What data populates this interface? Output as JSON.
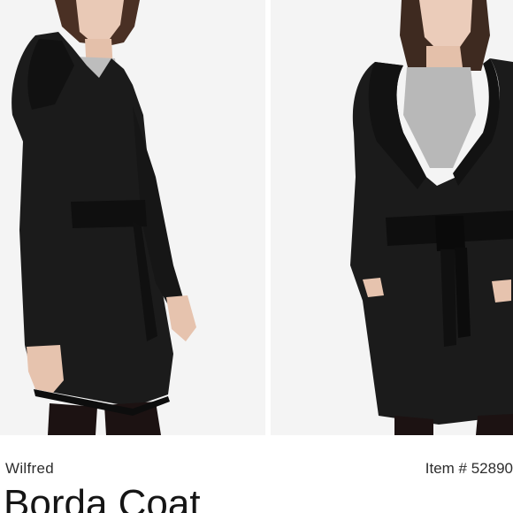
{
  "product": {
    "brand": "Wilfred",
    "item_number": "Item # 52890",
    "name": "Borda Coat"
  },
  "images": [
    {
      "description_icon": "product-photo-side-view",
      "background": "#f4f4f4",
      "garment_color": "#1a1a1a"
    },
    {
      "description_icon": "product-photo-front-view",
      "background": "#f4f4f4",
      "garment_color": "#1a1a1a"
    }
  ]
}
